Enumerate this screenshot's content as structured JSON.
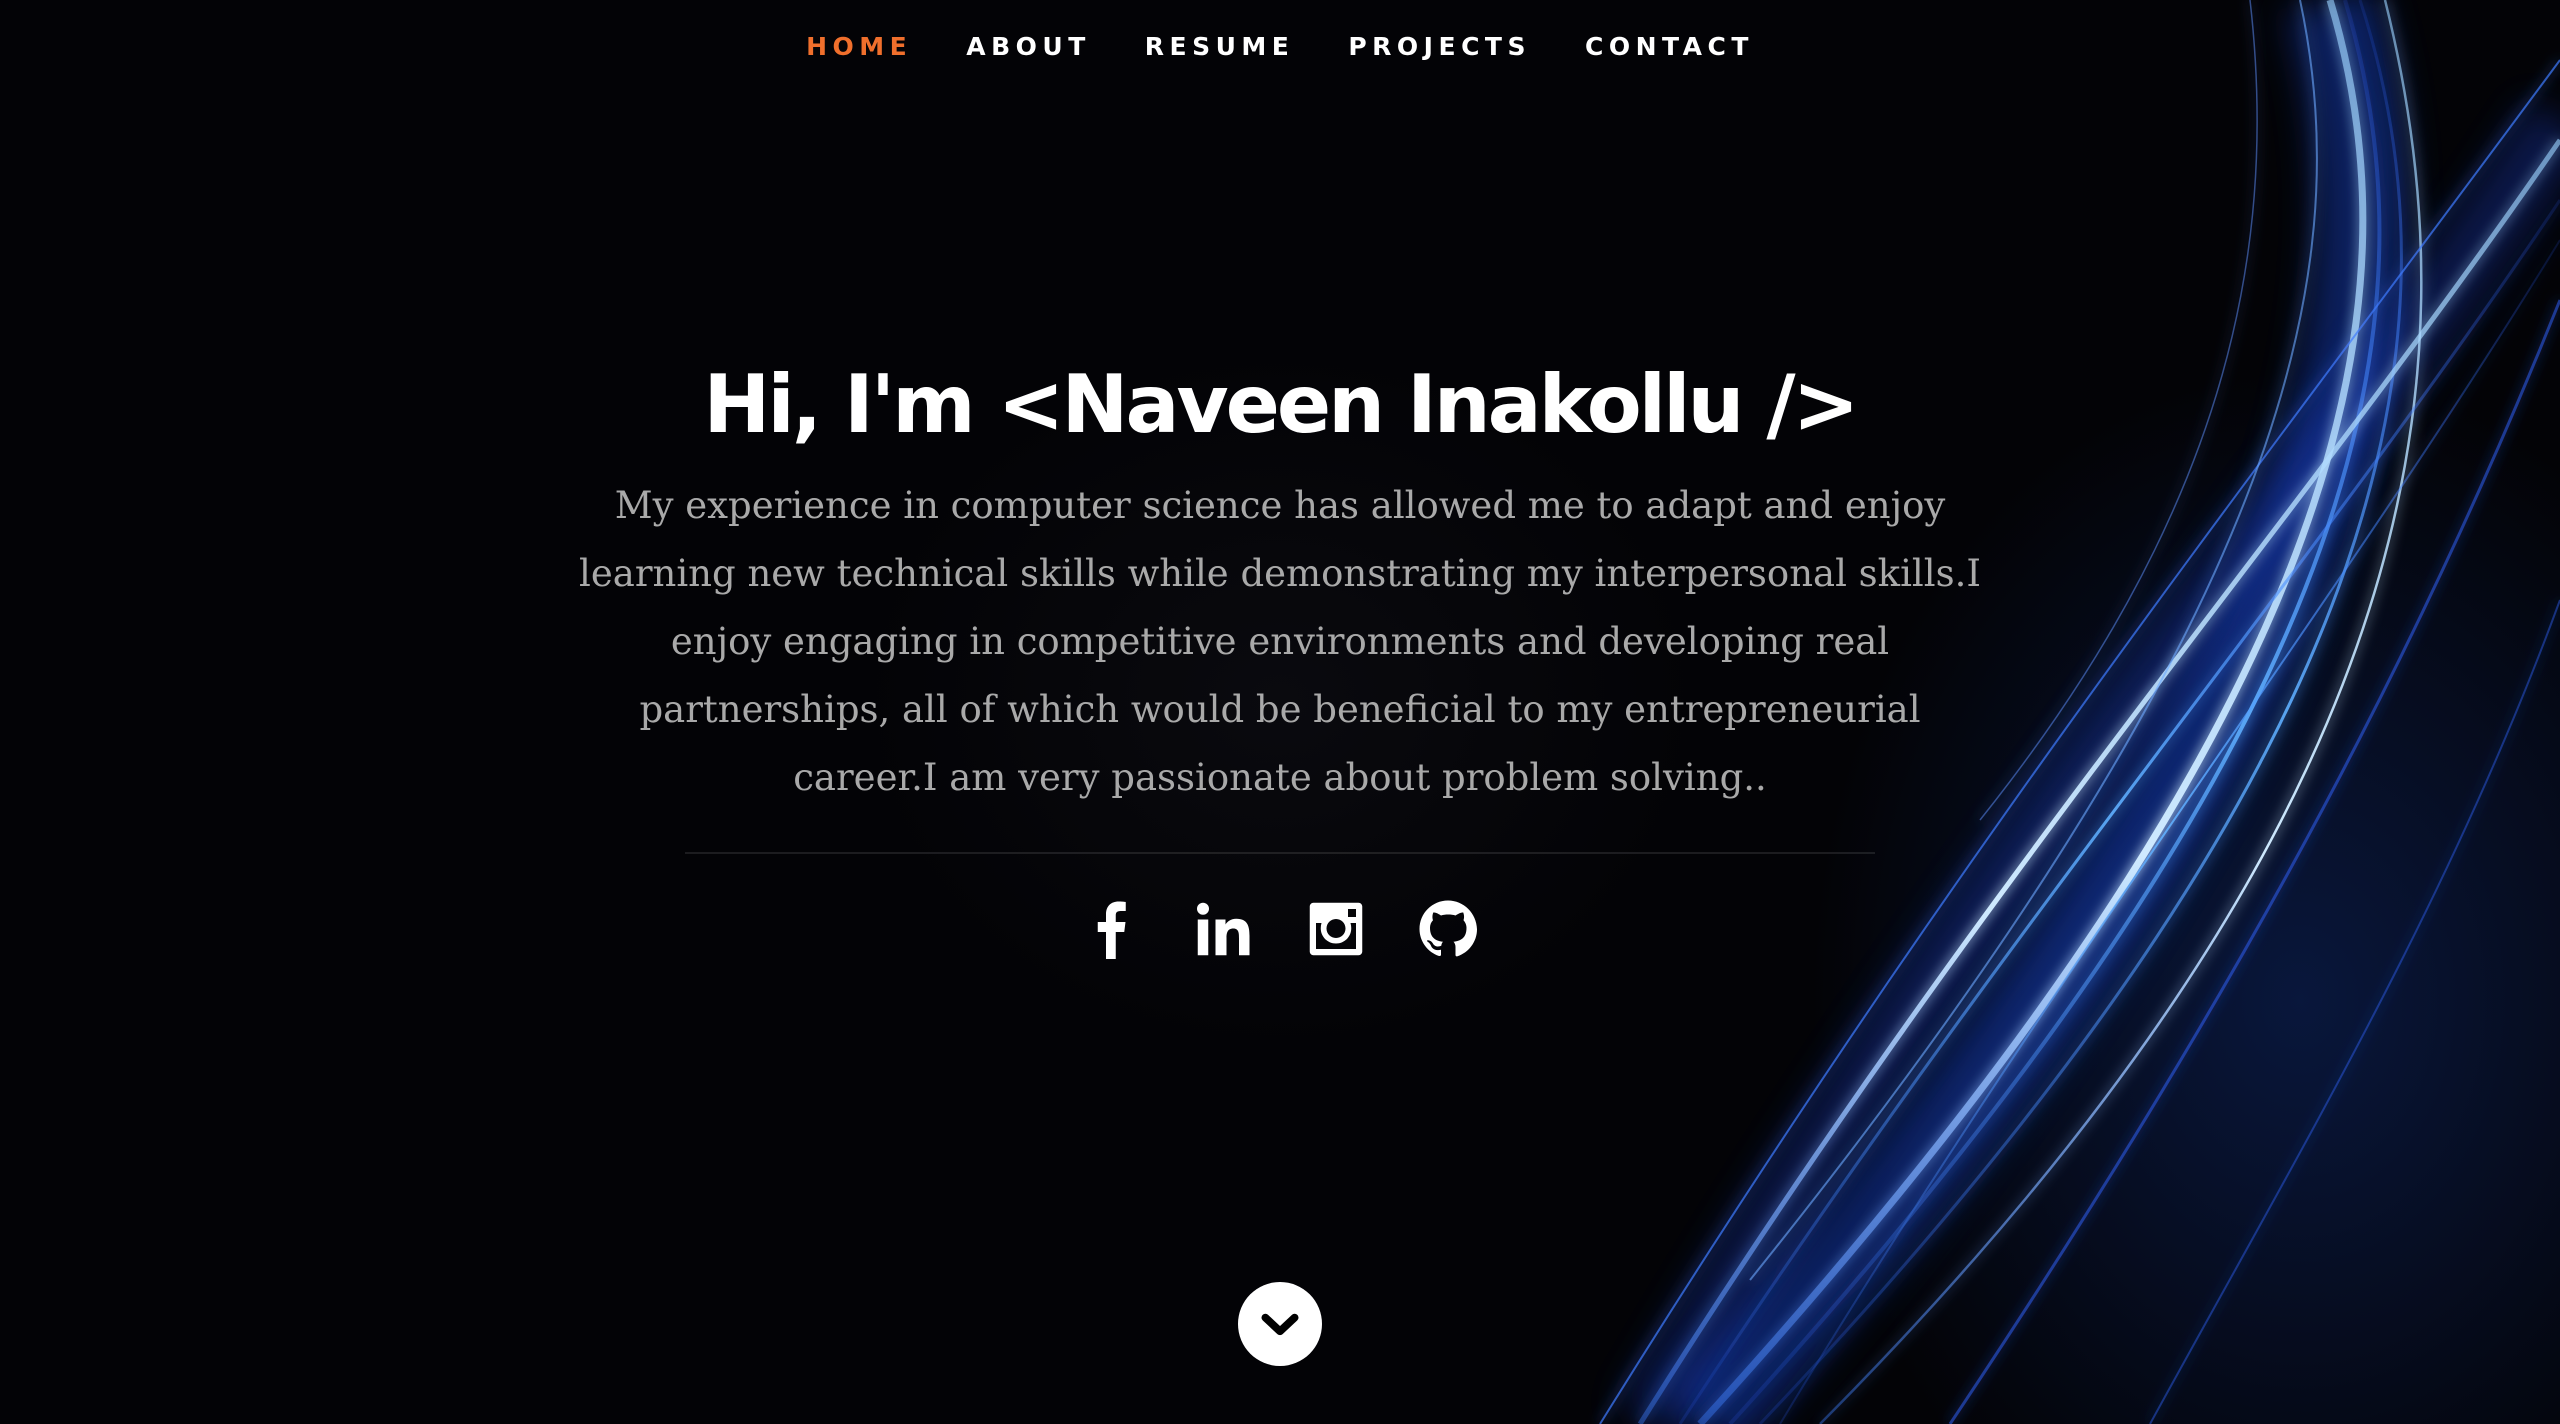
{
  "nav": {
    "items": [
      {
        "label": "HOME",
        "active": true
      },
      {
        "label": "ABOUT",
        "active": false
      },
      {
        "label": "RESUME",
        "active": false
      },
      {
        "label": "PROJECTS",
        "active": false
      },
      {
        "label": "CONTACT",
        "active": false
      }
    ],
    "active_color": "#f06f2c"
  },
  "banner": {
    "headline": "Hi, I'm <Naveen Inakollu />",
    "description": "My experience in computer science has allowed me to adapt and enjoy learning new technical skills while demonstrating my interpersonal skills.I enjoy engaging in competitive environments and developing real partnerships, all of which would be beneficial to my entrepreneurial career.I am very passionate about problem solving.."
  },
  "social": [
    {
      "icon": "facebook-icon"
    },
    {
      "icon": "linkedin-icon"
    },
    {
      "icon": "instagram-icon"
    },
    {
      "icon": "github-icon"
    }
  ],
  "scroll_down": {
    "icon": "chevron-down-icon"
  }
}
